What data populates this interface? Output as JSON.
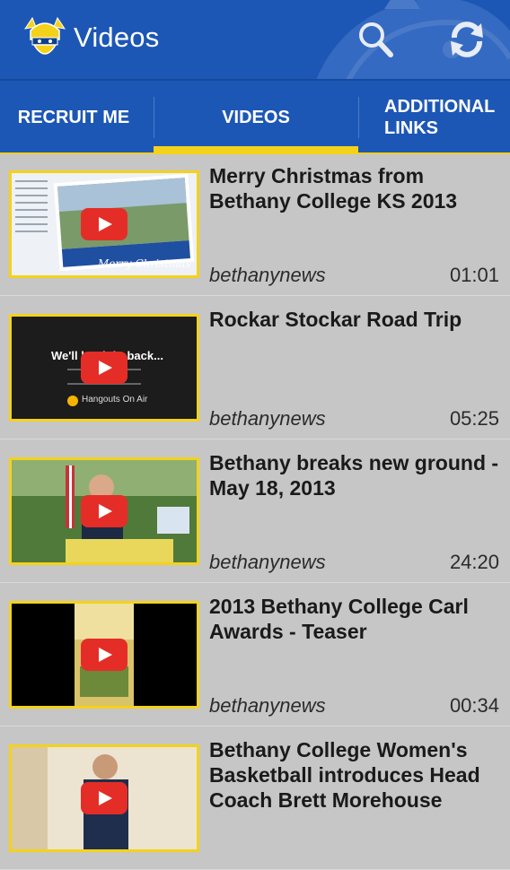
{
  "app": {
    "title": "Videos"
  },
  "tabs": [
    {
      "label": "RECRUIT ME"
    },
    {
      "label": "VIDEOS"
    },
    {
      "label": "ADDITIONAL LINKS"
    }
  ],
  "videos": [
    {
      "title": "Merry Christmas from Bethany College KS 2013",
      "author": "bethanynews",
      "duration": "01:01"
    },
    {
      "title": "Rockar Stockar Road Trip",
      "author": "bethanynews",
      "duration": "05:25"
    },
    {
      "title": "Bethany breaks new ground - May 18, 2013",
      "author": "bethanynews",
      "duration": "24:20"
    },
    {
      "title": "2013 Bethany College Carl Awards - Teaser",
      "author": "bethanynews",
      "duration": "00:34"
    },
    {
      "title": "Bethany College Women's Basketball introduces Head Coach Brett Morehouse",
      "author": "",
      "duration": ""
    }
  ],
  "thumbnails": {
    "video0": {
      "caption": "Merry Christmas"
    },
    "video1": {
      "overlay_text": "We'll be right back...",
      "badge": "Hangouts On Air"
    }
  },
  "colors": {
    "primary": "#1d57b5",
    "accent": "#f4d21a",
    "list_bg": "#c6c6c6",
    "play": "#e52d27"
  },
  "icons": {
    "logo": "viking-mascot-logo",
    "search": "search-icon",
    "refresh": "refresh-icon"
  }
}
